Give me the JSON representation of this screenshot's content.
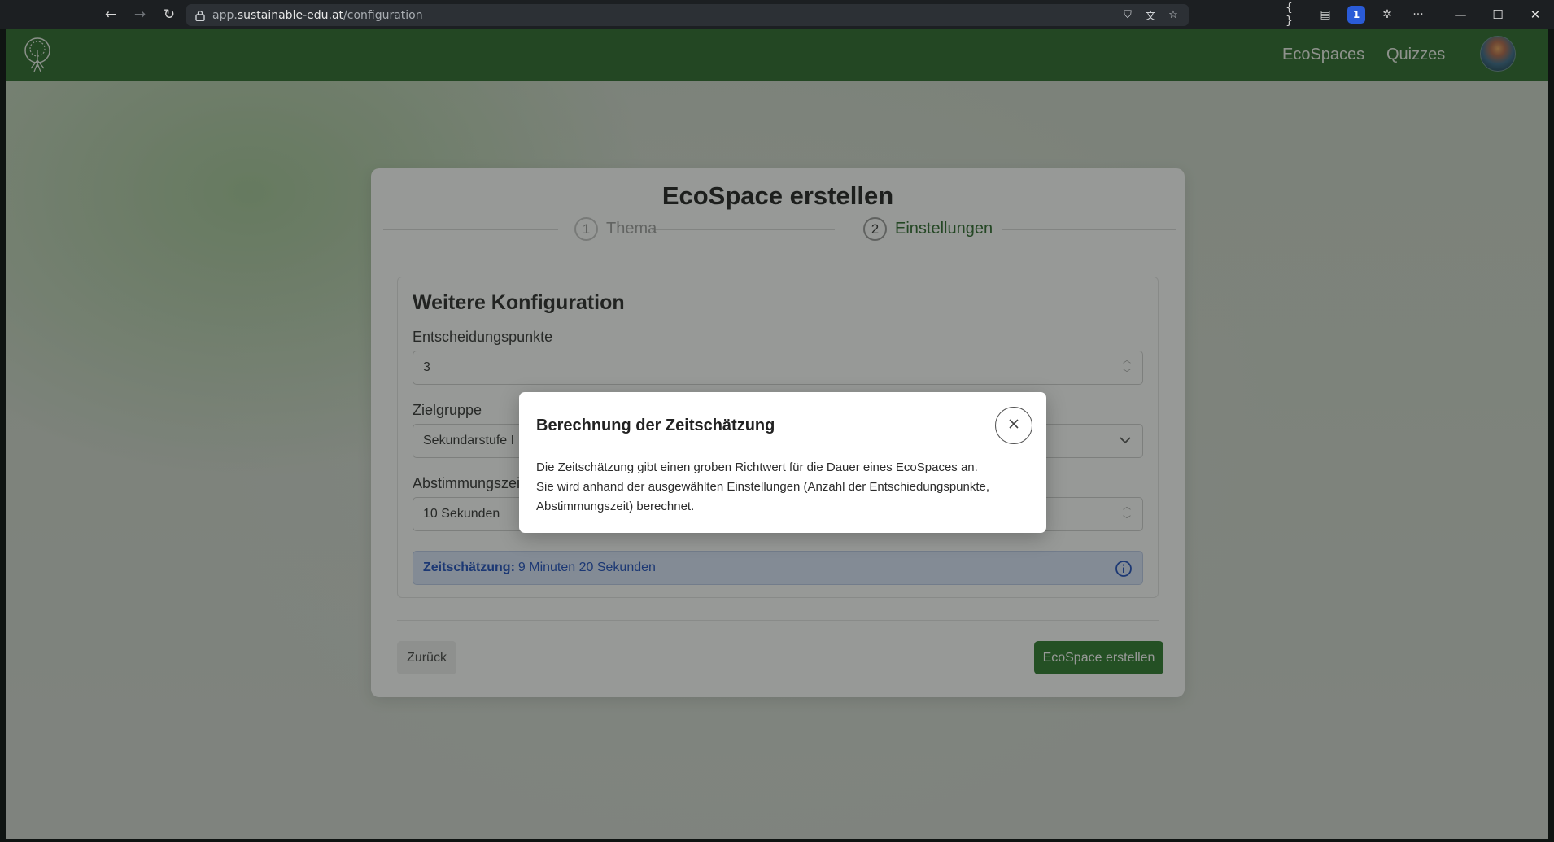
{
  "browser": {
    "url_prefix": "app.",
    "url_host": "sustainable-edu.at",
    "url_path": "/configuration",
    "extension_badge": "1"
  },
  "header": {
    "nav_ecospaces": "EcoSpaces",
    "nav_quizzes": "Quizzes"
  },
  "card": {
    "title": "EcoSpace erstellen",
    "steps": [
      {
        "number": "1",
        "label": "Thema"
      },
      {
        "number": "2",
        "label": "Einstellungen"
      }
    ],
    "panel_title": "Weitere Konfiguration",
    "fields": {
      "decision_points_label": "Entscheidungspunkte",
      "decision_points_value": "3",
      "target_group_label": "Zielgruppe",
      "target_group_value": "Sekundarstufe I",
      "voting_time_label": "Abstimmungszeit",
      "voting_time_value": "10 Sekunden"
    },
    "estimate_label": "Zeitschätzung:",
    "estimate_value": "9 Minuten 20 Sekunden",
    "back_label": "Zurück",
    "create_label": "EcoSpace erstellen"
  },
  "modal": {
    "title": "Berechnung der Zeitschätzung",
    "line1": "Die Zeitschätzung gibt einen groben Richtwert für die Dauer eines EcoSpaces an.",
    "line2": "Sie wird anhand der ausgewählten Einstellungen (Anzahl der Entschiedungspunkte, Abstimmungszeit) berechnet."
  },
  "colors": {
    "header_green": "#2c6a2c",
    "primary_button": "#2f7a2f",
    "info_blue": "#1f4fbf",
    "info_bg": "#dbe6fb"
  }
}
